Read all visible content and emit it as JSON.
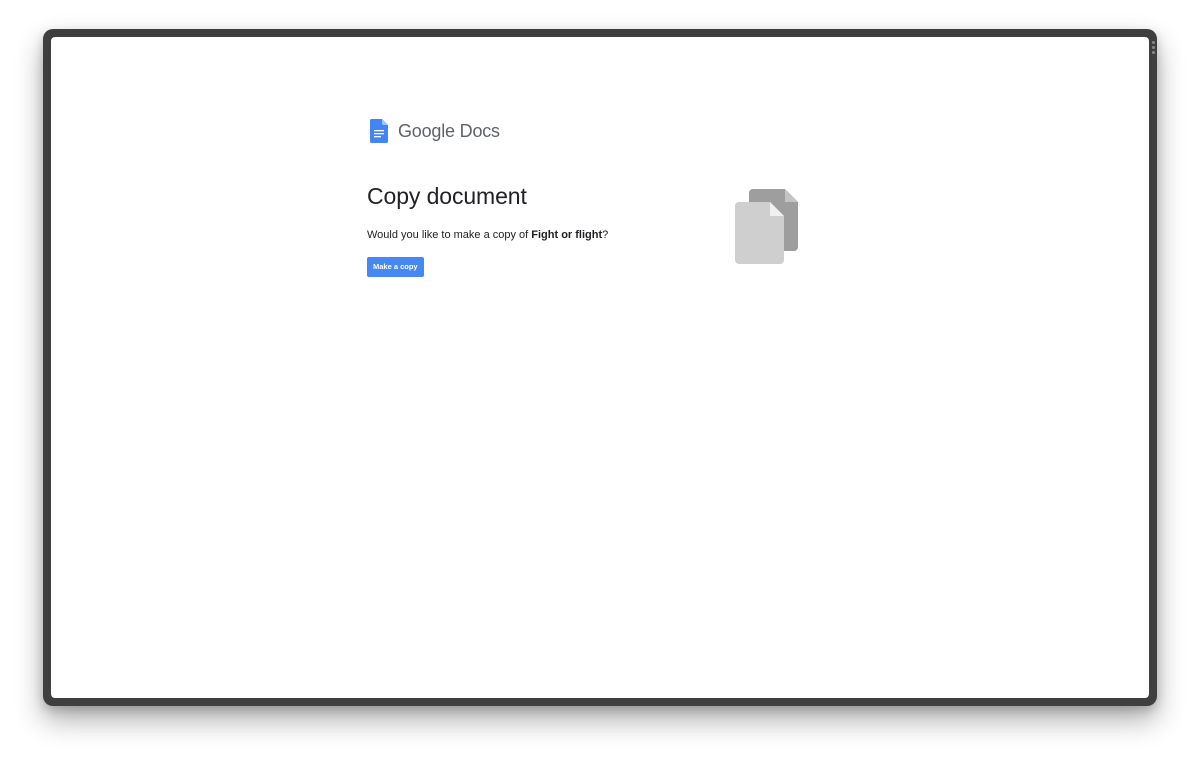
{
  "app": {
    "logo_text": "Google Docs",
    "icon": "google-docs-icon"
  },
  "page": {
    "title": "Copy document",
    "prompt_prefix": "Would you like to make a copy of ",
    "document_name": "Fight or flight",
    "prompt_suffix": "?",
    "make_copy_label": "Make a copy",
    "illustration_icon": "copy-documents-icon"
  },
  "colors": {
    "accent": "#4688f1",
    "docs_blue": "#4285f4",
    "text": "#202124",
    "logo_text": "#5f6368",
    "illustration_back": "#9e9e9e",
    "illustration_front": "#cfcfcf"
  }
}
